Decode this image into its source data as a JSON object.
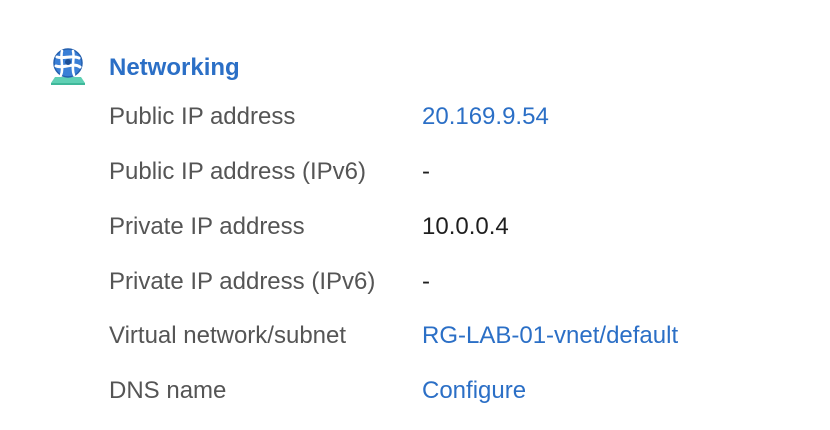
{
  "section": {
    "title": "Networking",
    "icon": "networking-globe-icon",
    "accent_color": "#2b6fc6"
  },
  "properties": [
    {
      "label": "Public IP address",
      "value": "20.169.9.54",
      "is_link": true
    },
    {
      "label": "Public IP address (IPv6)",
      "value": "-",
      "is_link": false
    },
    {
      "label": "Private IP address",
      "value": "10.0.0.4",
      "is_link": false
    },
    {
      "label": "Private IP address (IPv6)",
      "value": "-",
      "is_link": false
    },
    {
      "label": "Virtual network/subnet",
      "value": "RG-LAB-01-vnet/default",
      "is_link": true
    },
    {
      "label": "DNS name",
      "value": "Configure",
      "is_link": true
    }
  ]
}
